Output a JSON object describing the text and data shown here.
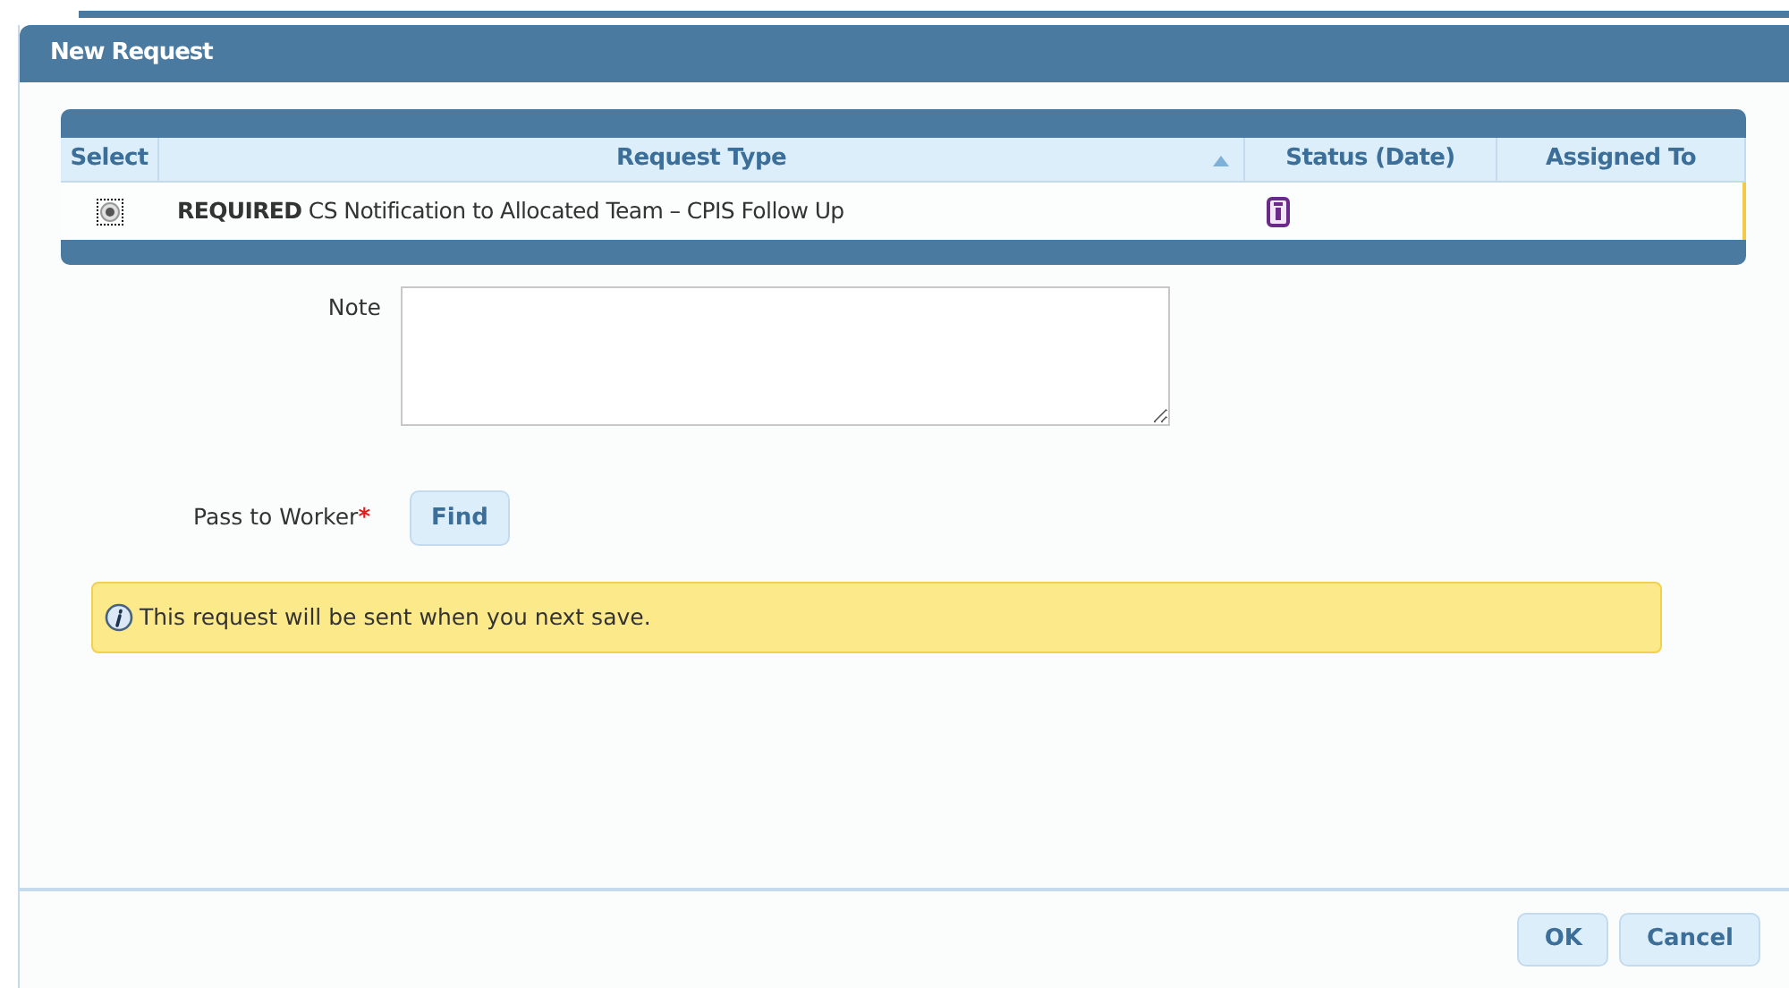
{
  "dialog": {
    "title": "New Request"
  },
  "table": {
    "columns": [
      {
        "label": "Select",
        "sorted": false
      },
      {
        "label": "Request Type",
        "sorted": true
      },
      {
        "label": "Status (Date)",
        "sorted": false
      },
      {
        "label": "Assigned To",
        "sorted": false
      }
    ],
    "rows": [
      {
        "selected": true,
        "request_type": "**REQUIRED** CS Notification to Allocated Team – CPIS Follow Up",
        "status": {
          "kind": "info"
        }
      }
    ]
  },
  "note": {
    "label": "Note"
  },
  "worker": {
    "label": "Pass to Worker",
    "required_mark": "*",
    "button": "Find"
  },
  "info": {
    "message": "This request will be sent when you next save."
  },
  "buttons": [
    "OK",
    "Cancel"
  ]
}
